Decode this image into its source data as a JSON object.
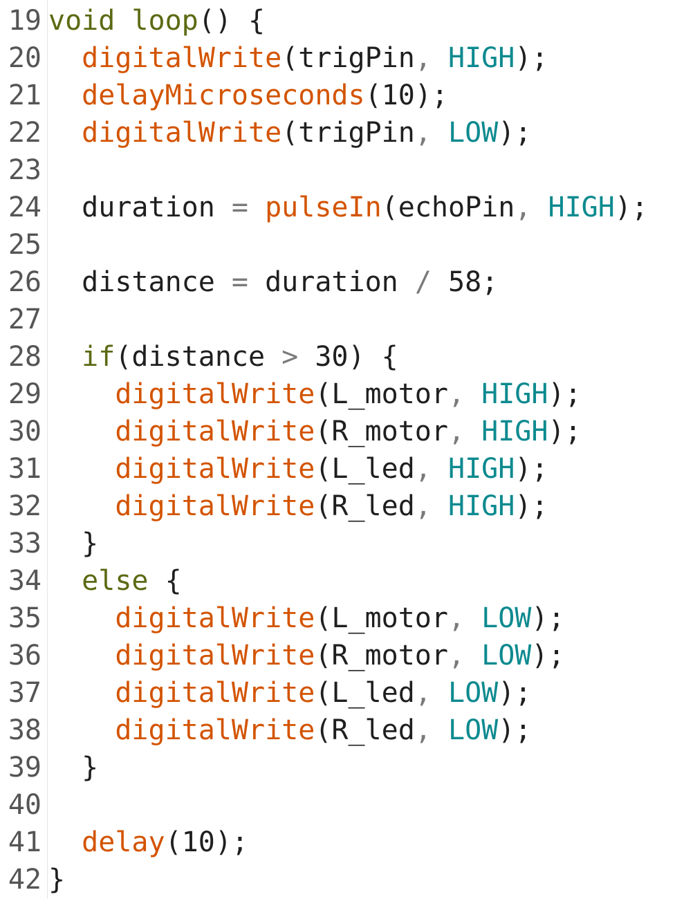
{
  "editor": {
    "lines": [
      {
        "num": "19",
        "tokens": [
          {
            "t": "void",
            "c": "kw"
          },
          {
            "t": " ",
            "c": "plain"
          },
          {
            "t": "loop",
            "c": "kw"
          },
          {
            "t": "() {",
            "c": "plain"
          }
        ]
      },
      {
        "num": "20",
        "tokens": [
          {
            "t": "  ",
            "c": "plain"
          },
          {
            "t": "digitalWrite",
            "c": "fn"
          },
          {
            "t": "(trigPin",
            "c": "plain"
          },
          {
            "t": ", ",
            "c": "op"
          },
          {
            "t": "HIGH",
            "c": "const"
          },
          {
            "t": ");",
            "c": "plain"
          }
        ]
      },
      {
        "num": "21",
        "tokens": [
          {
            "t": "  ",
            "c": "plain"
          },
          {
            "t": "delayMicroseconds",
            "c": "fn"
          },
          {
            "t": "(10);",
            "c": "plain"
          }
        ]
      },
      {
        "num": "22",
        "tokens": [
          {
            "t": "  ",
            "c": "plain"
          },
          {
            "t": "digitalWrite",
            "c": "fn"
          },
          {
            "t": "(trigPin",
            "c": "plain"
          },
          {
            "t": ", ",
            "c": "op"
          },
          {
            "t": "LOW",
            "c": "const"
          },
          {
            "t": ");",
            "c": "plain"
          }
        ]
      },
      {
        "num": "23",
        "tokens": []
      },
      {
        "num": "24",
        "tokens": [
          {
            "t": "  duration ",
            "c": "plain"
          },
          {
            "t": "= ",
            "c": "op"
          },
          {
            "t": "pulseIn",
            "c": "fn"
          },
          {
            "t": "(echoPin",
            "c": "plain"
          },
          {
            "t": ", ",
            "c": "op"
          },
          {
            "t": "HIGH",
            "c": "const"
          },
          {
            "t": ");",
            "c": "plain"
          }
        ]
      },
      {
        "num": "25",
        "tokens": []
      },
      {
        "num": "26",
        "tokens": [
          {
            "t": "  distance ",
            "c": "plain"
          },
          {
            "t": "= ",
            "c": "op"
          },
          {
            "t": "duration ",
            "c": "plain"
          },
          {
            "t": "/ ",
            "c": "op"
          },
          {
            "t": "58;",
            "c": "plain"
          }
        ]
      },
      {
        "num": "27",
        "tokens": []
      },
      {
        "num": "28",
        "tokens": [
          {
            "t": "  ",
            "c": "plain"
          },
          {
            "t": "if",
            "c": "kw"
          },
          {
            "t": "(distance ",
            "c": "plain"
          },
          {
            "t": "> ",
            "c": "op"
          },
          {
            "t": "30) {",
            "c": "plain"
          }
        ]
      },
      {
        "num": "29",
        "tokens": [
          {
            "t": "    ",
            "c": "plain"
          },
          {
            "t": "digitalWrite",
            "c": "fn"
          },
          {
            "t": "(L_motor",
            "c": "plain"
          },
          {
            "t": ", ",
            "c": "op"
          },
          {
            "t": "HIGH",
            "c": "const"
          },
          {
            "t": ");",
            "c": "plain"
          }
        ]
      },
      {
        "num": "30",
        "tokens": [
          {
            "t": "    ",
            "c": "plain"
          },
          {
            "t": "digitalWrite",
            "c": "fn"
          },
          {
            "t": "(R_motor",
            "c": "plain"
          },
          {
            "t": ", ",
            "c": "op"
          },
          {
            "t": "HIGH",
            "c": "const"
          },
          {
            "t": ");",
            "c": "plain"
          }
        ]
      },
      {
        "num": "31",
        "tokens": [
          {
            "t": "    ",
            "c": "plain"
          },
          {
            "t": "digitalWrite",
            "c": "fn"
          },
          {
            "t": "(L_led",
            "c": "plain"
          },
          {
            "t": ", ",
            "c": "op"
          },
          {
            "t": "HIGH",
            "c": "const"
          },
          {
            "t": ");",
            "c": "plain"
          }
        ]
      },
      {
        "num": "32",
        "tokens": [
          {
            "t": "    ",
            "c": "plain"
          },
          {
            "t": "digitalWrite",
            "c": "fn"
          },
          {
            "t": "(R_led",
            "c": "plain"
          },
          {
            "t": ", ",
            "c": "op"
          },
          {
            "t": "HIGH",
            "c": "const"
          },
          {
            "t": ");",
            "c": "plain"
          }
        ]
      },
      {
        "num": "33",
        "tokens": [
          {
            "t": "  }",
            "c": "plain"
          }
        ]
      },
      {
        "num": "34",
        "tokens": [
          {
            "t": "  ",
            "c": "plain"
          },
          {
            "t": "else",
            "c": "kw"
          },
          {
            "t": " {",
            "c": "plain"
          }
        ]
      },
      {
        "num": "35",
        "tokens": [
          {
            "t": "    ",
            "c": "plain"
          },
          {
            "t": "digitalWrite",
            "c": "fn"
          },
          {
            "t": "(L_motor",
            "c": "plain"
          },
          {
            "t": ", ",
            "c": "op"
          },
          {
            "t": "LOW",
            "c": "const"
          },
          {
            "t": ");",
            "c": "plain"
          }
        ]
      },
      {
        "num": "36",
        "tokens": [
          {
            "t": "    ",
            "c": "plain"
          },
          {
            "t": "digitalWrite",
            "c": "fn"
          },
          {
            "t": "(R_motor",
            "c": "plain"
          },
          {
            "t": ", ",
            "c": "op"
          },
          {
            "t": "LOW",
            "c": "const"
          },
          {
            "t": ");",
            "c": "plain"
          }
        ]
      },
      {
        "num": "37",
        "tokens": [
          {
            "t": "    ",
            "c": "plain"
          },
          {
            "t": "digitalWrite",
            "c": "fn"
          },
          {
            "t": "(L_led",
            "c": "plain"
          },
          {
            "t": ", ",
            "c": "op"
          },
          {
            "t": "LOW",
            "c": "const"
          },
          {
            "t": ");",
            "c": "plain"
          }
        ]
      },
      {
        "num": "38",
        "tokens": [
          {
            "t": "    ",
            "c": "plain"
          },
          {
            "t": "digitalWrite",
            "c": "fn"
          },
          {
            "t": "(R_led",
            "c": "plain"
          },
          {
            "t": ", ",
            "c": "op"
          },
          {
            "t": "LOW",
            "c": "const"
          },
          {
            "t": ");",
            "c": "plain"
          }
        ]
      },
      {
        "num": "39",
        "tokens": [
          {
            "t": "  }",
            "c": "plain"
          }
        ]
      },
      {
        "num": "40",
        "tokens": []
      },
      {
        "num": "41",
        "tokens": [
          {
            "t": "  ",
            "c": "plain"
          },
          {
            "t": "delay",
            "c": "fn"
          },
          {
            "t": "(10);",
            "c": "plain"
          }
        ]
      },
      {
        "num": "42",
        "tokens": [
          {
            "t": "}",
            "c": "plain"
          }
        ]
      }
    ]
  },
  "colors": {
    "keyword": "#5b6a12",
    "function": "#d35400",
    "constant": "#0d8a8f",
    "plain": "#1f1f1f",
    "line_number": "#555555"
  }
}
